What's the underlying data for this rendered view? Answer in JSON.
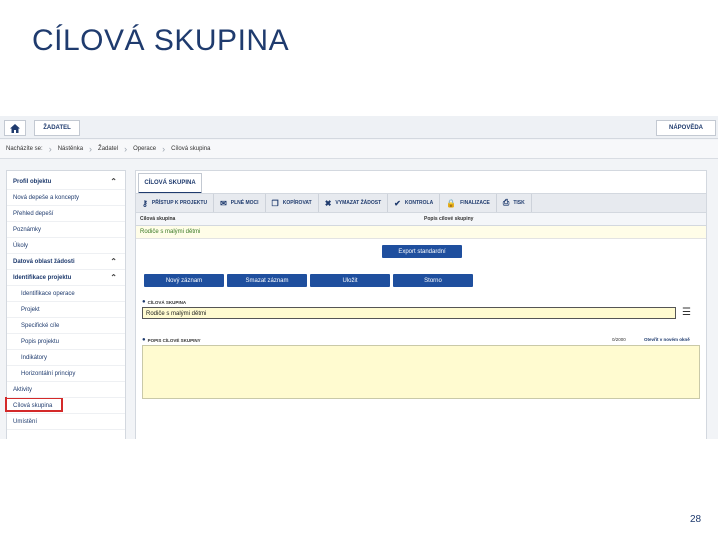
{
  "slide": {
    "title": "CÍLOVÁ SKUPINA",
    "page_number": "28"
  },
  "app": {
    "topbar": {
      "home_icon": "home-icon",
      "zadatel": "ŽADATEL",
      "napoveda": "NÁPOVĚDA"
    },
    "breadcrumbs": [
      "Nacházíte se:",
      "Nástěnka",
      "Žadatel",
      "Operace",
      "Cílová skupina"
    ],
    "sidebar": {
      "items": [
        {
          "label": "Profil objektu",
          "head": true,
          "chevron": "chevron-up-icon"
        },
        {
          "label": "Nová depeše a koncepty"
        },
        {
          "label": "Přehled depeší"
        },
        {
          "label": "Poznámky"
        },
        {
          "label": "Úkoly"
        },
        {
          "label": "Datová oblast žádosti",
          "head": true,
          "chevron": "chevron-up-icon"
        },
        {
          "label": "Identifikace projektu",
          "head": true,
          "chevron": "chevron-up-icon"
        },
        {
          "label": "Identifikace operace",
          "sub": true
        },
        {
          "label": "Projekt",
          "sub": true
        },
        {
          "label": "Specifické cíle",
          "sub": true
        },
        {
          "label": "Popis projektu",
          "sub": true
        },
        {
          "label": "Indikátory",
          "sub": true
        },
        {
          "label": "Horizontální principy",
          "sub": true
        },
        {
          "label": "Aktivity"
        },
        {
          "label": "Cílová skupina",
          "selected": true
        },
        {
          "label": "Umístění"
        }
      ]
    },
    "main": {
      "tab": "CÍLOVÁ SKUPINA",
      "toolbar": [
        {
          "label": "PŘÍSTUP K PROJEKTU",
          "icon": "key-icon",
          "glyph": "⚷"
        },
        {
          "label": "PLNÉ MOCI",
          "icon": "envelope-icon",
          "glyph": "✉"
        },
        {
          "label": "KOPÍROVAT",
          "icon": "copy-icon",
          "glyph": "❐"
        },
        {
          "label": "VYMAZAT ŽÁDOST",
          "icon": "delete-icon",
          "glyph": "✖"
        },
        {
          "label": "KONTROLA",
          "icon": "check-icon",
          "glyph": "✔"
        },
        {
          "label": "FINALIZACE",
          "icon": "lock-icon",
          "glyph": "🔒"
        },
        {
          "label": "TISK",
          "icon": "print-icon",
          "glyph": "⎙"
        }
      ],
      "grid": {
        "columns": [
          "Cílová skupina",
          "Popis cílové skupiny"
        ],
        "rows": [
          [
            "Rodiče s malými dětmi",
            ""
          ]
        ]
      },
      "export_label": "Export standardní",
      "actions": [
        "Nový záznam",
        "Smazat záznam",
        "Uložit",
        "Storno"
      ],
      "field_cilova": {
        "label": "CÍLOVÁ SKUPINA",
        "value": "Rodiče s malými dětmi",
        "list_icon": "list-icon"
      },
      "field_popis": {
        "label": "POPIS CÍLOVÉ SKUPINY",
        "counter": "0/2000",
        "open_link": "Otevřít v novém okně"
      }
    }
  }
}
